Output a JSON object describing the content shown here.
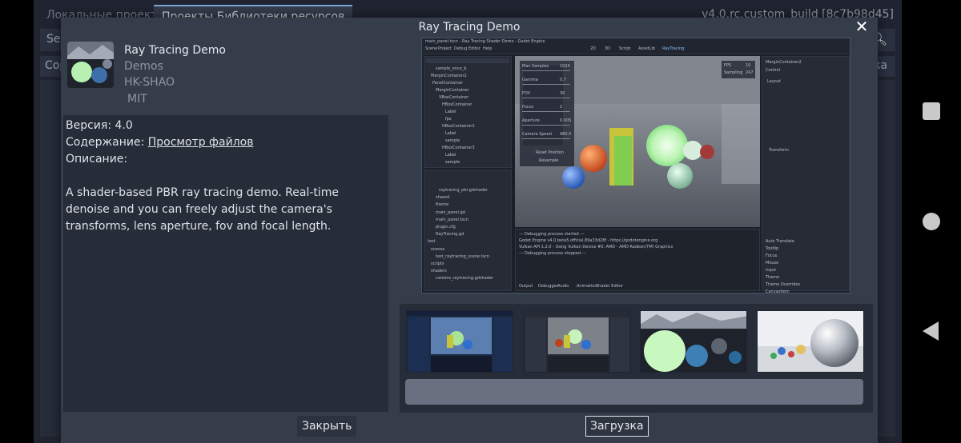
{
  "background": {
    "tab_local": "Локальные проекты",
    "tab_library": "Проекты Библиотеки ресурсов",
    "version": "v4.0.rc.custom_build [8c7b98d45]",
    "search_stub": "Sea",
    "sort_stub": "Сор",
    "right_stub": "кка"
  },
  "dialog": {
    "title": "Ray Tracing Demo",
    "close_glyph": "✕",
    "asset": {
      "name": "Ray Tracing Demo",
      "category": "Demos",
      "author": "HK-SHAO",
      "license": "MIT"
    },
    "description": {
      "version_line": "Версия: 4.0",
      "content_label": "Содержание: ",
      "content_link": "Просмотр файлов",
      "description_label": "Описание:",
      "text": "A shader-based PBR ray tracing demo. Real-time denoise and you can freely adjust the camera's transforms, lens aperture, fov and focal length."
    },
    "preview": {
      "window_title": "main_panel.tscn - Ray Tracing Shader Demo - Godot Engine",
      "menu": [
        "Scene",
        "Project",
        "Debug",
        "Editor",
        "Help"
      ],
      "workspaces": [
        "2D",
        "3D",
        "Script",
        "AssetLib",
        "RayTracing"
      ],
      "scene_tree": [
        "sample_once_b",
        "MarginContainer2",
        "PanelContainer",
        "MarginContainer",
        "VBoxContainer",
        "HBoxContainer",
        "Label",
        "fps",
        "HBoxContainer2",
        "Label",
        "sample",
        "HBoxContainer3",
        "Label",
        "sample"
      ],
      "file_list": [
        "raytracing_pbr.gdshader",
        "shared",
        "theme",
        "main_panel.gd",
        "main_panel.tscn",
        "plugin.cfg",
        "RayTracing.gd",
        "test",
        "scenes",
        "test_raytracing_scene.tscn",
        "scripts",
        "shaders",
        "camera_raytracing.gdshader"
      ],
      "params": [
        {
          "label": "Max Samples",
          "value": "1024"
        },
        {
          "label": "Gamma",
          "value": "0.7"
        },
        {
          "label": "FOV",
          "value": "30"
        },
        {
          "label": "Focus",
          "value": "2"
        },
        {
          "label": "Aperture",
          "value": "0.005"
        },
        {
          "label": "Camera Speed",
          "value": "980.5"
        }
      ],
      "buttons": [
        "Reset Position",
        "Resample"
      ],
      "stats": [
        {
          "label": "FPS",
          "value": "10"
        },
        {
          "label": "Sampling",
          "value": "247"
        }
      ],
      "inspector_node": "MarginContainer2",
      "inspector_sections": [
        "Control",
        "Layout",
        "Transform",
        "Auto Translate",
        "Tooltip",
        "Focus",
        "Mouse",
        "Input",
        "Theme",
        "Theme Overrides",
        "CanvasItem"
      ],
      "console": [
        "--- Debugging process started ---",
        "Godot Engine v4.0.beta5.official.89a33d28f - https://godotengine.org",
        "Vulkan API 1.2.0 - Using Vulkan Device #0: AMD - AMD Radeon(TM) Graphics",
        "--- Debugging process stopped ---"
      ],
      "bottom_tabs": [
        "Output",
        "Debugger",
        "Audio",
        "Animation",
        "Shader Editor"
      ]
    },
    "buttons": {
      "close": "Закрыть",
      "download": "Загрузка"
    }
  }
}
